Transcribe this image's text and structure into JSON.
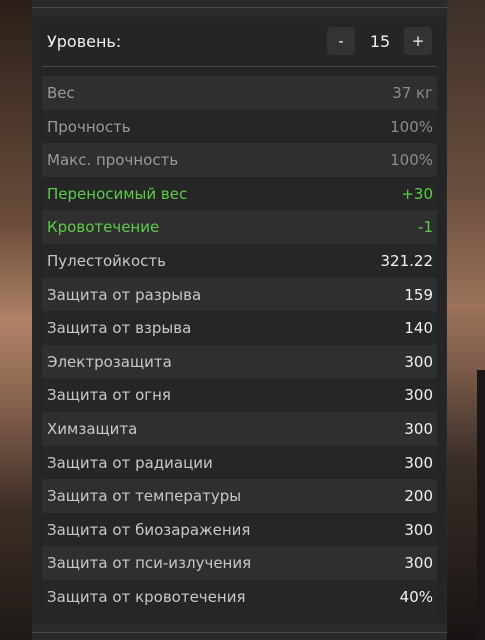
{
  "level": {
    "label": "Уровень:",
    "value": "15",
    "minus_label": "-",
    "plus_label": "+"
  },
  "stats": [
    {
      "name": "Вес",
      "value": "37 кг",
      "style": "muted"
    },
    {
      "name": "Прочность",
      "value": "100%",
      "style": "muted"
    },
    {
      "name": "Макс. прочность",
      "value": "100%",
      "style": "muted"
    },
    {
      "name": "Переносимый вес",
      "value": "+30",
      "style": "green"
    },
    {
      "name": "Кровотечение",
      "value": "-1",
      "style": "green"
    },
    {
      "name": "Пулестойкость",
      "value": "321.22",
      "style": "normal"
    },
    {
      "name": "Защита от разрыва",
      "value": "159",
      "style": "normal"
    },
    {
      "name": "Защита от взрыва",
      "value": "140",
      "style": "normal"
    },
    {
      "name": "Электрозащита",
      "value": "300",
      "style": "normal"
    },
    {
      "name": "Защита от огня",
      "value": "300",
      "style": "normal"
    },
    {
      "name": "Химзащита",
      "value": "300",
      "style": "normal"
    },
    {
      "name": "Защита от радиации",
      "value": "300",
      "style": "normal"
    },
    {
      "name": "Защита от температуры",
      "value": "200",
      "style": "normal"
    },
    {
      "name": "Защита от биозаражения",
      "value": "300",
      "style": "normal"
    },
    {
      "name": "Защита от пси-излучения",
      "value": "300",
      "style": "normal"
    },
    {
      "name": "Защита от кровотечения",
      "value": "40%",
      "style": "normal"
    }
  ],
  "colors": {
    "panel_bg": "#2a2a2a",
    "row_light": "#2f2f2f",
    "row_dark": "#262626",
    "positive_green": "#5ccc4a",
    "muted_text": "#9a9a9a",
    "primary_text": "#f2f2f2"
  }
}
